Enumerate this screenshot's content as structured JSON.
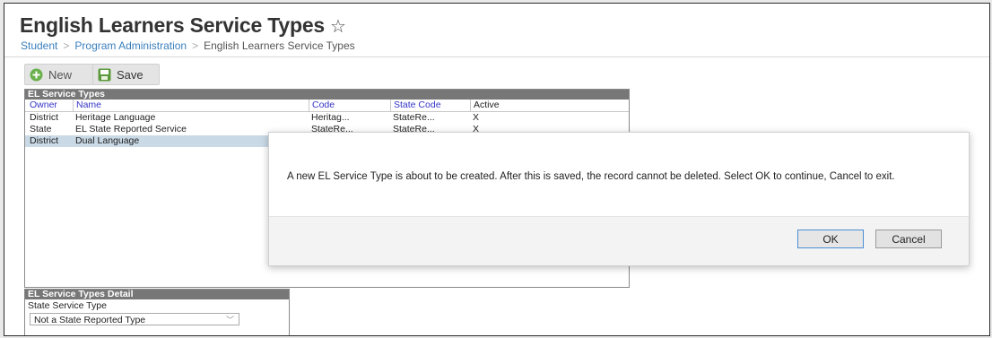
{
  "page": {
    "title": "English Learners Service Types",
    "star": "☆"
  },
  "breadcrumb": {
    "items": [
      "Student",
      "Program Administration",
      "English Learners Service Types"
    ],
    "separator": ">"
  },
  "toolbar": {
    "new_label": "New",
    "save_label": "Save",
    "new_icon": "plus-circle-icon",
    "save_icon": "floppy-disk-icon",
    "new_icon_color": "#6ab04c",
    "save_icon_color": "#5b9a3c"
  },
  "list_panel": {
    "title": "EL Service Types",
    "columns": [
      "Owner",
      "Name",
      "Code",
      "State Code",
      "Active"
    ],
    "rows": [
      {
        "owner": "District",
        "name": "Heritage Language",
        "code": "Heritag...",
        "state_code": "StateRe...",
        "active": "X"
      },
      {
        "owner": "State",
        "name": "EL State Reported Service",
        "code": "StateRe...",
        "state_code": "StateRe...",
        "active": "X"
      },
      {
        "owner": "District",
        "name": "Dual Language",
        "code": "",
        "state_code": "",
        "active": ""
      }
    ],
    "selected_row": 2
  },
  "detail_panel": {
    "title": "EL Service Types Detail",
    "field_label": "State Service Type",
    "field_value": "Not a State Reported Type"
  },
  "modal": {
    "message": "A new EL Service Type is about to be created.  After this is saved, the record cannot be deleted.  Select OK to continue, Cancel to exit.",
    "ok_label": "OK",
    "cancel_label": "Cancel"
  },
  "colors": {
    "link": "#3a7fbd",
    "column_header": "#3535c8",
    "panel_title_bg": "#777777",
    "selected_row": "#c9d9e6",
    "ok_focus_border": "#4a8fd6"
  }
}
